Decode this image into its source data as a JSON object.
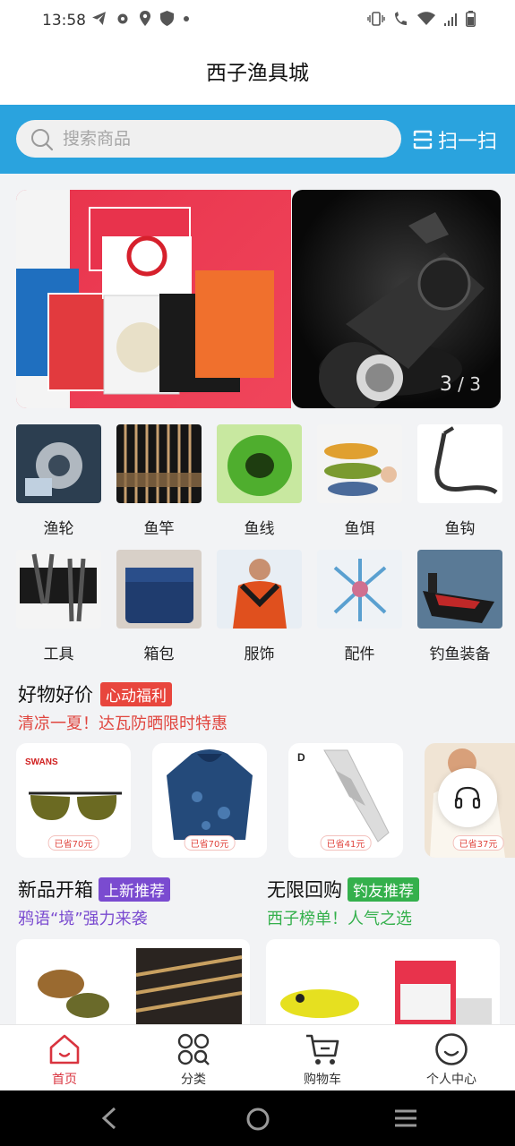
{
  "status": {
    "time": "13:58"
  },
  "header": {
    "title": "西子渔具城"
  },
  "search": {
    "placeholder": "搜索商品",
    "scan_label": "扫一扫"
  },
  "banner": {
    "current": "3",
    "total": "/ 3"
  },
  "categories": [
    {
      "label": "渔轮",
      "icon": "fishing-reel"
    },
    {
      "label": "鱼竿",
      "icon": "fishing-rod"
    },
    {
      "label": "鱼线",
      "icon": "fishing-line"
    },
    {
      "label": "鱼饵",
      "icon": "fishing-lure"
    },
    {
      "label": "鱼钩",
      "icon": "fish-hook"
    },
    {
      "label": "工具",
      "icon": "pliers"
    },
    {
      "label": "箱包",
      "icon": "tackle-bag"
    },
    {
      "label": "服饰",
      "icon": "apparel"
    },
    {
      "label": "配件",
      "icon": "accessory"
    },
    {
      "label": "钓鱼装备",
      "icon": "fishing-boat"
    }
  ],
  "deals": {
    "title": "好物好价",
    "tag": "心动福利",
    "subtitle": "清凉一夏！达瓦防晒限时特惠",
    "items": [
      {
        "brand": "SWANS",
        "badge": "已省70元"
      },
      {
        "badge": "已省70元"
      },
      {
        "brand": "D",
        "badge": "已省41元"
      },
      {
        "badge": "已省37元"
      }
    ]
  },
  "new_arrivals": {
    "title": "新品开箱",
    "tag": "上新推荐",
    "subtitle": "鸦语“境”强力来袭"
  },
  "repurchase": {
    "title": "无限回购",
    "tag": "钓友推荐",
    "subtitle": "西子榜单！人气之选"
  },
  "nav": [
    {
      "label": "首页"
    },
    {
      "label": "分类"
    },
    {
      "label": "购物车"
    },
    {
      "label": "个人中心"
    }
  ],
  "colors": {
    "accent_blue": "#2aa3de",
    "deal_red": "#e0453e",
    "purple": "#7a4bd0",
    "green": "#34b04c",
    "nav_active": "#d9343f"
  }
}
